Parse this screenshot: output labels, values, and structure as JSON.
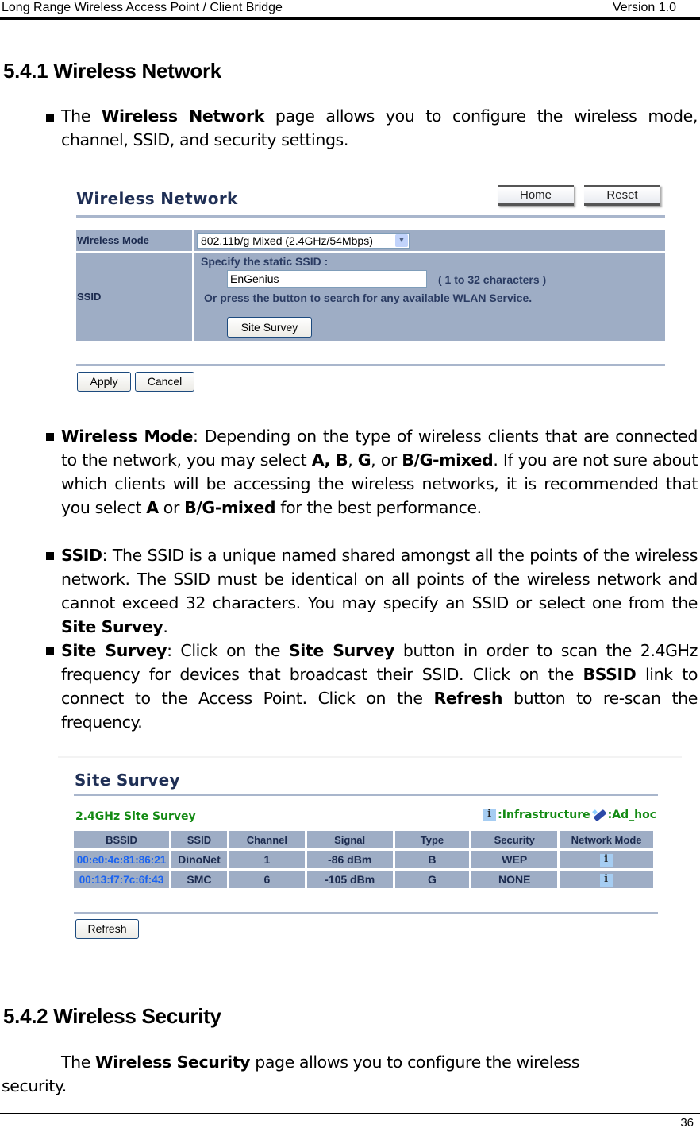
{
  "header": {
    "title": "Long Range Wireless Access Point / Client Bridge",
    "version": "Version 1.0"
  },
  "section1": {
    "heading": "5.4.1 Wireless Network",
    "intro": {
      "pre": "The ",
      "bold": "Wireless Network",
      "post": " page allows you to configure the wireless mode, channel, SSID, and security settings."
    }
  },
  "wireless_network_ui": {
    "title": "Wireless Network",
    "home_label": "Home",
    "reset_label": "Reset",
    "wireless_mode_label": "Wireless Mode",
    "wireless_mode_value": "802.11b/g Mixed (2.4GHz/54Mbps)",
    "ssid_label": "SSID",
    "specify_text": "Specify the static SSID  :",
    "ssid_value": "EnGenius",
    "ssid_hint": "( 1 to 32 characters )",
    "search_text": "Or press the button to search for any available WLAN Service.",
    "site_survey_label": "Site Survey",
    "apply_label": "Apply",
    "cancel_label": "Cancel"
  },
  "bullets": {
    "wireless_mode": {
      "term": "Wireless Mode",
      "t1": ": Depending on the type of wireless clients that are connected to the network, you may select ",
      "b1": "A, B",
      "t2": ", ",
      "b2": "G",
      "t3": ", or ",
      "b3": "B/G-mixed",
      "t4": ". If you are not sure about which clients will be accessing the wireless networks, it is recommended that you select ",
      "b4": "A",
      "t5": " or ",
      "b5": "B/G-mixed",
      "t6": " for the best performance."
    },
    "ssid": {
      "term": "SSID",
      "t1": ": The SSID is a unique named shared amongst all the points of the wireless network. The SSID must be identical on all points of the wireless network and cannot exceed 32 characters. You may specify an SSID or select one from the ",
      "b1": "Site Survey",
      "t2": "."
    },
    "site_survey": {
      "term": "Site Survey",
      "t1": ": Click on the ",
      "b1": "Site Survey",
      "t2": " button in order to scan the 2.4GHz frequency for devices that broadcast their SSID. Click on the ",
      "b2": "BSSID",
      "t3": " link to connect to the Access Point. Click on the ",
      "b3": "Refresh",
      "t4": " button to re-scan the frequency."
    }
  },
  "site_survey_ui": {
    "title": "Site Survey",
    "subtitle": "2.4GHz Site Survey",
    "legend_infra": ":Infrastructure",
    "legend_adhoc": ":Ad_hoc",
    "columns": [
      "BSSID",
      "SSID",
      "Channel",
      "Signal",
      "Type",
      "Security",
      "Network Mode"
    ],
    "rows": [
      {
        "bssid": "00:e0:4c:81:86:21",
        "ssid": "DinoNet",
        "channel": "1",
        "signal": "-86 dBm",
        "type": "B",
        "security": "WEP",
        "mode_icon": "infrastructure-icon"
      },
      {
        "bssid": "00:13:f7:7c:6f:43",
        "ssid": "SMC",
        "channel": "6",
        "signal": "-105 dBm",
        "type": "G",
        "security": "NONE",
        "mode_icon": "infrastructure-icon"
      }
    ],
    "refresh_label": "Refresh"
  },
  "section2": {
    "heading": "5.4.2 Wireless Security",
    "intro": {
      "pre": "The ",
      "bold": "Wireless Security",
      "post": " page allows you to configure the wireless"
    },
    "continuation": "security."
  },
  "footer": {
    "page_number": "36"
  }
}
